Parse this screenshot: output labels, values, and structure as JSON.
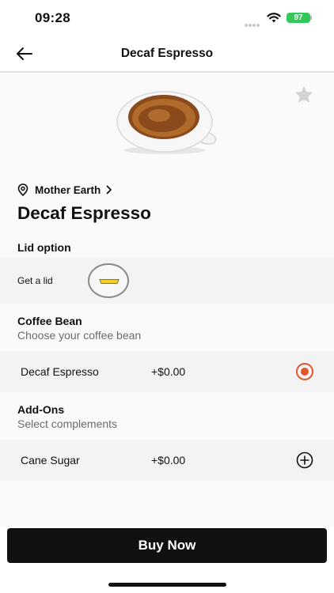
{
  "status_bar": {
    "time": "09:28",
    "battery": "97"
  },
  "nav": {
    "title": "Decaf Espresso",
    "back_icon": "arrow-left-icon"
  },
  "hero": {
    "image": "espresso-cup",
    "favorite_icon": "star-icon"
  },
  "store": {
    "name": "Mother Earth",
    "icon": "location-pin-icon"
  },
  "product": {
    "title": "Decaf Espresso"
  },
  "lid": {
    "section_title": "Lid option",
    "label": "Get a lid",
    "toggle_color": "#f3d22c"
  },
  "coffee_bean": {
    "section_title": "Coffee Bean",
    "subtitle": "Choose your coffee bean",
    "options": [
      {
        "name": "Decaf Espresso",
        "price": "+$0.00",
        "selected": true
      }
    ]
  },
  "addons": {
    "section_title": "Add-Ons",
    "subtitle": "Select complements",
    "options": [
      {
        "name": "Cane Sugar",
        "price": "+$0.00"
      }
    ]
  },
  "cta": {
    "label": "Buy Now"
  },
  "colors": {
    "accent": "#e0552a",
    "battery": "#34c759",
    "button": "#111111"
  }
}
